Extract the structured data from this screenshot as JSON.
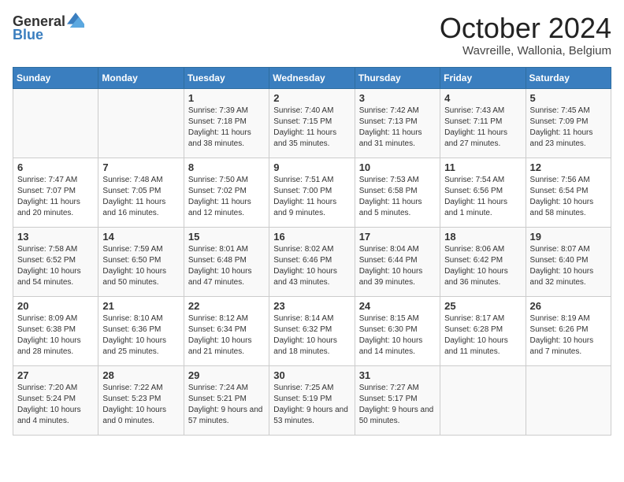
{
  "header": {
    "logo_general": "General",
    "logo_blue": "Blue",
    "month": "October 2024",
    "location": "Wavreille, Wallonia, Belgium"
  },
  "days_of_week": [
    "Sunday",
    "Monday",
    "Tuesday",
    "Wednesday",
    "Thursday",
    "Friday",
    "Saturday"
  ],
  "weeks": [
    [
      {
        "day": "",
        "info": ""
      },
      {
        "day": "",
        "info": ""
      },
      {
        "day": "1",
        "info": "Sunrise: 7:39 AM\nSunset: 7:18 PM\nDaylight: 11 hours and 38 minutes."
      },
      {
        "day": "2",
        "info": "Sunrise: 7:40 AM\nSunset: 7:15 PM\nDaylight: 11 hours and 35 minutes."
      },
      {
        "day": "3",
        "info": "Sunrise: 7:42 AM\nSunset: 7:13 PM\nDaylight: 11 hours and 31 minutes."
      },
      {
        "day": "4",
        "info": "Sunrise: 7:43 AM\nSunset: 7:11 PM\nDaylight: 11 hours and 27 minutes."
      },
      {
        "day": "5",
        "info": "Sunrise: 7:45 AM\nSunset: 7:09 PM\nDaylight: 11 hours and 23 minutes."
      }
    ],
    [
      {
        "day": "6",
        "info": "Sunrise: 7:47 AM\nSunset: 7:07 PM\nDaylight: 11 hours and 20 minutes."
      },
      {
        "day": "7",
        "info": "Sunrise: 7:48 AM\nSunset: 7:05 PM\nDaylight: 11 hours and 16 minutes."
      },
      {
        "day": "8",
        "info": "Sunrise: 7:50 AM\nSunset: 7:02 PM\nDaylight: 11 hours and 12 minutes."
      },
      {
        "day": "9",
        "info": "Sunrise: 7:51 AM\nSunset: 7:00 PM\nDaylight: 11 hours and 9 minutes."
      },
      {
        "day": "10",
        "info": "Sunrise: 7:53 AM\nSunset: 6:58 PM\nDaylight: 11 hours and 5 minutes."
      },
      {
        "day": "11",
        "info": "Sunrise: 7:54 AM\nSunset: 6:56 PM\nDaylight: 11 hours and 1 minute."
      },
      {
        "day": "12",
        "info": "Sunrise: 7:56 AM\nSunset: 6:54 PM\nDaylight: 10 hours and 58 minutes."
      }
    ],
    [
      {
        "day": "13",
        "info": "Sunrise: 7:58 AM\nSunset: 6:52 PM\nDaylight: 10 hours and 54 minutes."
      },
      {
        "day": "14",
        "info": "Sunrise: 7:59 AM\nSunset: 6:50 PM\nDaylight: 10 hours and 50 minutes."
      },
      {
        "day": "15",
        "info": "Sunrise: 8:01 AM\nSunset: 6:48 PM\nDaylight: 10 hours and 47 minutes."
      },
      {
        "day": "16",
        "info": "Sunrise: 8:02 AM\nSunset: 6:46 PM\nDaylight: 10 hours and 43 minutes."
      },
      {
        "day": "17",
        "info": "Sunrise: 8:04 AM\nSunset: 6:44 PM\nDaylight: 10 hours and 39 minutes."
      },
      {
        "day": "18",
        "info": "Sunrise: 8:06 AM\nSunset: 6:42 PM\nDaylight: 10 hours and 36 minutes."
      },
      {
        "day": "19",
        "info": "Sunrise: 8:07 AM\nSunset: 6:40 PM\nDaylight: 10 hours and 32 minutes."
      }
    ],
    [
      {
        "day": "20",
        "info": "Sunrise: 8:09 AM\nSunset: 6:38 PM\nDaylight: 10 hours and 28 minutes."
      },
      {
        "day": "21",
        "info": "Sunrise: 8:10 AM\nSunset: 6:36 PM\nDaylight: 10 hours and 25 minutes."
      },
      {
        "day": "22",
        "info": "Sunrise: 8:12 AM\nSunset: 6:34 PM\nDaylight: 10 hours and 21 minutes."
      },
      {
        "day": "23",
        "info": "Sunrise: 8:14 AM\nSunset: 6:32 PM\nDaylight: 10 hours and 18 minutes."
      },
      {
        "day": "24",
        "info": "Sunrise: 8:15 AM\nSunset: 6:30 PM\nDaylight: 10 hours and 14 minutes."
      },
      {
        "day": "25",
        "info": "Sunrise: 8:17 AM\nSunset: 6:28 PM\nDaylight: 10 hours and 11 minutes."
      },
      {
        "day": "26",
        "info": "Sunrise: 8:19 AM\nSunset: 6:26 PM\nDaylight: 10 hours and 7 minutes."
      }
    ],
    [
      {
        "day": "27",
        "info": "Sunrise: 7:20 AM\nSunset: 5:24 PM\nDaylight: 10 hours and 4 minutes."
      },
      {
        "day": "28",
        "info": "Sunrise: 7:22 AM\nSunset: 5:23 PM\nDaylight: 10 hours and 0 minutes."
      },
      {
        "day": "29",
        "info": "Sunrise: 7:24 AM\nSunset: 5:21 PM\nDaylight: 9 hours and 57 minutes."
      },
      {
        "day": "30",
        "info": "Sunrise: 7:25 AM\nSunset: 5:19 PM\nDaylight: 9 hours and 53 minutes."
      },
      {
        "day": "31",
        "info": "Sunrise: 7:27 AM\nSunset: 5:17 PM\nDaylight: 9 hours and 50 minutes."
      },
      {
        "day": "",
        "info": ""
      },
      {
        "day": "",
        "info": ""
      }
    ]
  ]
}
